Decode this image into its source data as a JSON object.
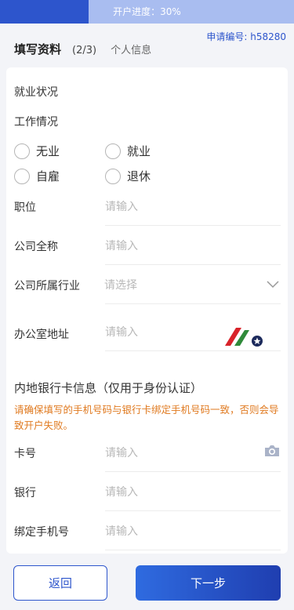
{
  "progress": {
    "text": "开户进度：30%",
    "percent": 30
  },
  "application_no": "申请编号: h58280",
  "header": {
    "title": "填写资料",
    "step": "(2/3)",
    "subtitle": "个人信息"
  },
  "employment": {
    "section_title": "就业状况",
    "work_label": "工作情况",
    "options": [
      "无业",
      "就业",
      "自雇",
      "退休"
    ]
  },
  "fields": {
    "position": {
      "label": "职位",
      "placeholder": "请输入"
    },
    "company": {
      "label": "公司全称",
      "placeholder": "请输入"
    },
    "industry": {
      "label": "公司所属行业",
      "placeholder": "请选择"
    },
    "office_address": {
      "label": "办公室地址",
      "placeholder": "请输入"
    }
  },
  "bank": {
    "section_title": "内地银行卡信息（仅用于身份认证）",
    "warning": "请确保填写的手机号码与银行卡绑定手机号码一致，否则会导致开户失败。",
    "card_no": {
      "label": "卡号",
      "placeholder": "请输入"
    },
    "bank_name": {
      "label": "银行",
      "placeholder": "请输入"
    },
    "phone": {
      "label": "绑定手机号",
      "placeholder": "请输入"
    }
  },
  "buttons": {
    "back": "返回",
    "next": "下一步"
  },
  "colors": {
    "primary": "#2d55cc",
    "warning": "#e07b22",
    "logo_red": "#d8232a",
    "logo_green": "#2f8a3a",
    "logo_navy": "#1c2a5c"
  }
}
